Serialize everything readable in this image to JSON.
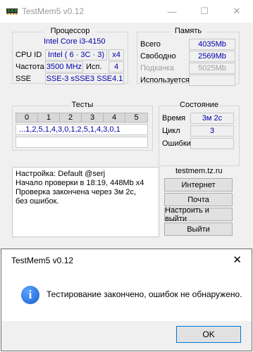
{
  "main": {
    "title": "TestMem5 v0.12",
    "window_controls": [
      "—",
      "☐",
      "✕"
    ],
    "processor": {
      "title": "Процессор",
      "name": "Intel Core i3-4150",
      "cpuid_label": "CPU ID",
      "cpuid_value": "Intel  ( 6 · 3C · 3)",
      "threads": "x4",
      "freq_label": "Частота",
      "freq_value": "3500 MHz",
      "used_label": "Исп.",
      "used_value": "4",
      "sse_label": "SSE",
      "sse_value": "SSE-3 sSSE3 SSE4.1"
    },
    "memory": {
      "title": "Память",
      "total_label": "Всего",
      "total_value": "4035Mb",
      "free_label": "Свободно",
      "free_value": "2569Mb",
      "swap_label": "Подкачка",
      "swap_value": "5025Mb",
      "used_label": "Используется",
      "used_value": ""
    },
    "tests": {
      "title": "Тесты",
      "headers": [
        "0",
        "1",
        "2",
        "3",
        "4",
        "5"
      ],
      "sequence": "...1,2,5,1,4,3,0,1,2,5,1,4,3,0,1"
    },
    "status": {
      "title": "Состояние",
      "time_label": "Время",
      "time_value": "3м 2с",
      "cycle_label": "Цикл",
      "cycle_value": "3",
      "errors_label": "Ошибки",
      "errors_value": ""
    },
    "log": "Настройка: Default @serj\nНачало проверки в 18:19, 448Mb x4\nПроверка закончена через 3м 2с,\nбез ошибок.",
    "site": {
      "title": "testmem.tz.ru",
      "buttons": [
        "Интернет",
        "Почта",
        "Настроить и выйти",
        "Выйти"
      ]
    }
  },
  "dialog": {
    "title": "TestMem5 v0.12",
    "close": "✕",
    "message": "Тестирование закончено, ошибок не обнаружено.",
    "ok_label": "OK",
    "icon": "info-icon"
  }
}
